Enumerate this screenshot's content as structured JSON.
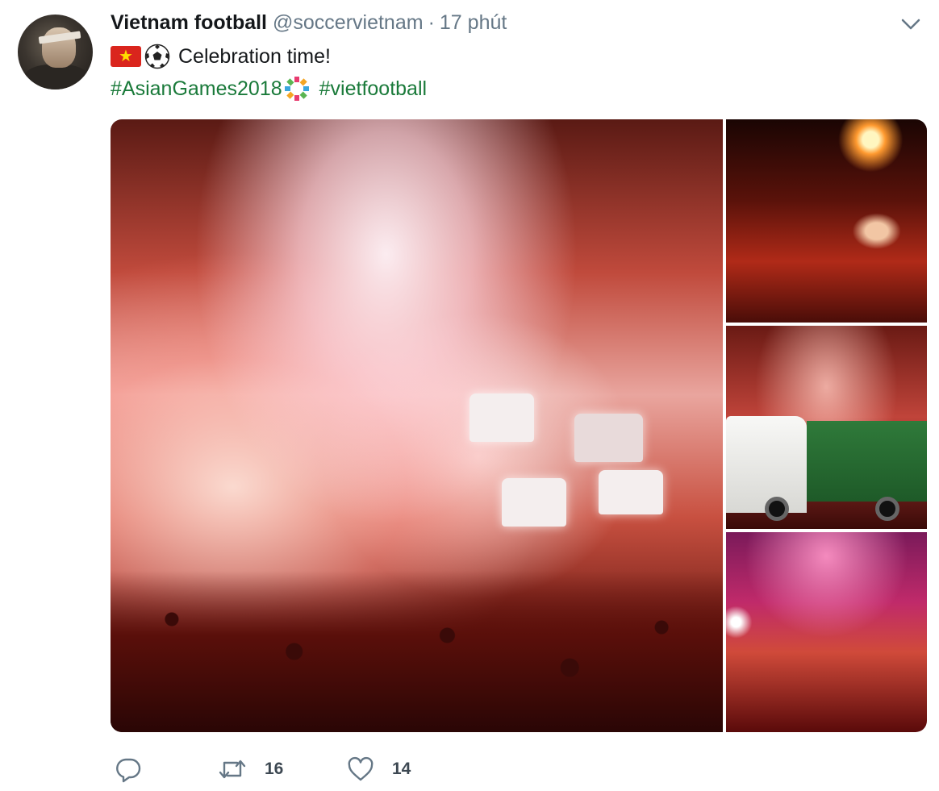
{
  "tweet": {
    "author_name": "Vietnam football",
    "handle": "@soccervietnam",
    "separator": "·",
    "time": "17 phút",
    "text": "Celebration time!",
    "flag_glyph": "★",
    "hashtags": [
      "#AsianGames2018",
      "#vietfootball"
    ]
  },
  "icons": {
    "menu": "chevron-down-icon",
    "reply": "reply-icon",
    "retweet": "retweet-icon",
    "like": "heart-icon",
    "flag": "vietnam-flag-icon",
    "ball": "soccer-ball-icon",
    "games": "asian-games-emblem-icon"
  },
  "actions": {
    "retweet_count": "16",
    "like_count": "14"
  },
  "colors": {
    "hashtag": "#1a7a3a",
    "secondary_text": "#657786",
    "flag_red": "#da251d",
    "flag_star": "#ffde00"
  }
}
